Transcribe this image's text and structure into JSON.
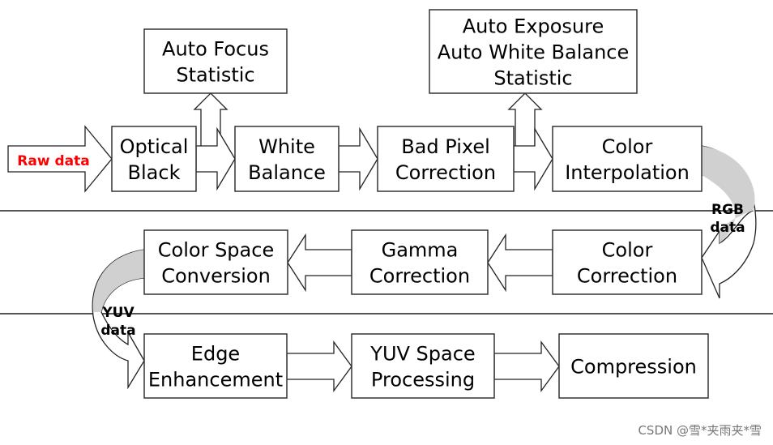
{
  "input_label": "Raw data",
  "input_color": "#ff0000",
  "boxes": {
    "af": [
      "Auto Focus",
      "Statistic"
    ],
    "ae": [
      "Auto Exposure",
      "Auto White Balance",
      "Statistic"
    ],
    "ob": [
      "Optical",
      "Black"
    ],
    "wb": [
      "White",
      "Balance"
    ],
    "bpc": [
      "Bad Pixel",
      "Correction"
    ],
    "ci": [
      "Color",
      "Interpolation"
    ],
    "csc": [
      "Color Space",
      "Conversion"
    ],
    "gc": [
      "Gamma",
      "Correction"
    ],
    "cc": [
      "Color",
      "Correction"
    ],
    "ee": [
      "Edge",
      "Enhancement"
    ],
    "yuv": [
      "YUV Space",
      "Processing"
    ],
    "comp": [
      "Compression"
    ]
  },
  "transitions": {
    "rgb": [
      "RGB",
      "data"
    ],
    "yuv": [
      "YUV",
      "data"
    ]
  },
  "watermark": "CSDN @雪*夹雨夹*雪"
}
